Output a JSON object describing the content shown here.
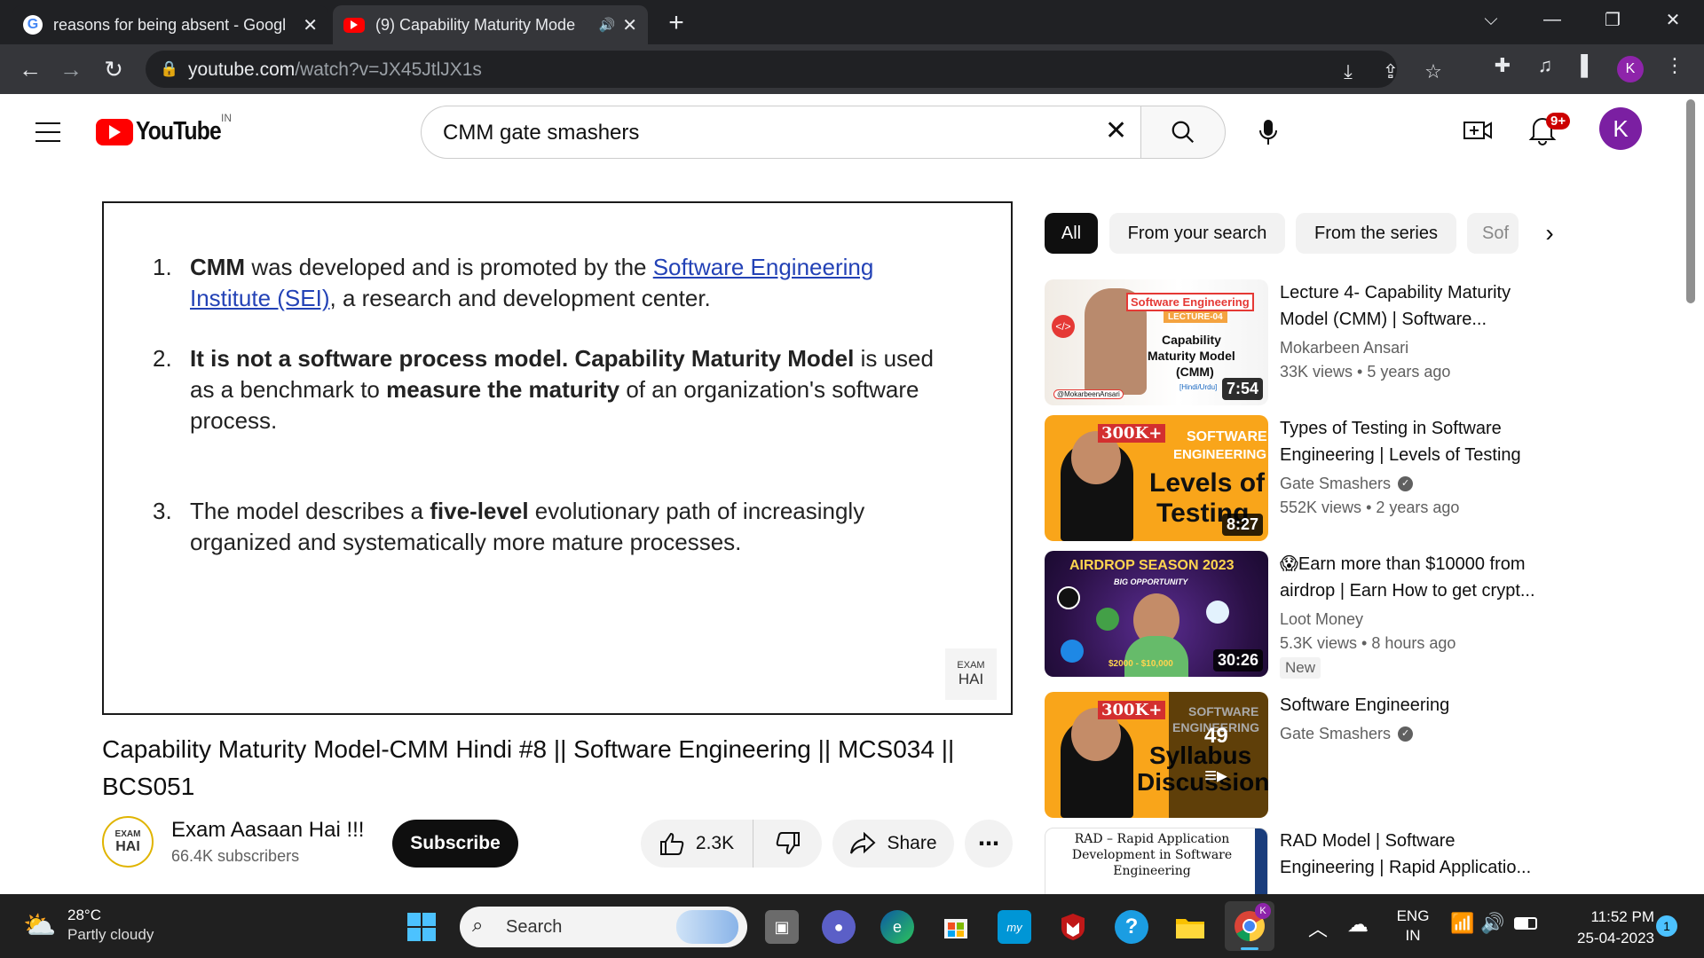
{
  "browser": {
    "tabs": [
      {
        "title": "reasons for being absent - Googl",
        "icon": "google-icon"
      },
      {
        "title": "(9) Capability Maturity Mode",
        "icon": "youtube-icon",
        "audio": true
      }
    ],
    "url_host": "youtube.com",
    "url_path": "/watch?v=JX45JtlJX1s",
    "profile_initial": "K"
  },
  "youtube": {
    "logo_text": "YouTube",
    "country_code": "IN",
    "search_query": "CMM gate smashers",
    "notification_count": "9+",
    "avatar_initial": "K"
  },
  "slide": {
    "items": [
      {
        "num": "1.",
        "parts": [
          "CMM",
          " was developed and is promoted by the ",
          "Software Engineering Institute (SEI)",
          ", a research and development center."
        ]
      },
      {
        "num": "2.",
        "parts": [
          "It is not  a software process model.  Capability Maturity Model",
          " is used as a benchmark to ",
          "measure  the maturity",
          " of an organization's software process."
        ]
      },
      {
        "num": "3.",
        "parts": [
          "The model describes a ",
          "five-level",
          " evolutionary path of increasingly organized and systematically more mature processes."
        ]
      }
    ],
    "watermark_top": "EXAM",
    "watermark_bottom": "HAI"
  },
  "video": {
    "title": "Capability Maturity Model-CMM Hindi #8 || Software Engineering || MCS034 || BCS051",
    "channel_name": "Exam Aasaan Hai !!!",
    "subscribers": "66.4K subscribers",
    "subscribe_label": "Subscribe",
    "likes": "2.3K",
    "share_label": "Share"
  },
  "chips": [
    "All",
    "From your search",
    "From the series",
    "Sof"
  ],
  "recommendations": [
    {
      "title": "Lecture 4- Capability Maturity Model (CMM) | Software...",
      "channel": "Mokarbeen Ansari",
      "views": "33K views",
      "age": "5 years ago",
      "duration": "7:54",
      "verified": false,
      "thumb_lines": [
        "Software Engineering",
        "LECTURE-04",
        "Capability",
        "Maturity Model",
        "(CMM)",
        "[Hindi/Urdu]",
        "@MokarbeenAnsari"
      ]
    },
    {
      "title": "Types of Testing in Software Engineering | Levels of Testing",
      "channel": "Gate Smashers",
      "views": "552K views",
      "age": "2 years ago",
      "duration": "8:27",
      "verified": true,
      "thumb_lines": [
        "300K+",
        "SOFTWARE",
        "ENGINEERING",
        "Levels of",
        "Testing"
      ]
    },
    {
      "title": "😱Earn more than $10000 from airdrop | Earn How to get crypt...",
      "channel": "Loot Money",
      "views": "5.3K views",
      "age": "8 hours ago",
      "duration": "30:26",
      "verified": false,
      "badge": "New",
      "thumb_lines": [
        "AIRDROP SEASON 2023",
        "BIG OPPORTUNITY",
        "$2000 - $10,000"
      ]
    },
    {
      "title": "Software Engineering",
      "channel": "Gate Smashers",
      "playlist_count": "49",
      "verified": true,
      "thumb_lines": [
        "300K+",
        "SOFTWARE",
        "ENGINEERING",
        "Syllabus",
        "Discussion"
      ]
    },
    {
      "title": "RAD Model | Software Engineering | Rapid Applicatio...",
      "thumb_lines": [
        "RAD – Rapid Application",
        "Development in Software",
        "Engineering"
      ]
    }
  ],
  "taskbar": {
    "temperature": "28°C",
    "weather": "Partly cloudy",
    "search_label": "Search",
    "lang_top": "ENG",
    "lang_bottom": "IN",
    "time": "11:52 PM",
    "date": "25-04-2023",
    "notification_count": "1",
    "chrome_profile": "K"
  },
  "colors": {
    "youtube_red": "#ff0000",
    "link_blue": "#2342b6",
    "avatar_purple": "#7b1fa2",
    "badge_red": "#cc0000"
  }
}
